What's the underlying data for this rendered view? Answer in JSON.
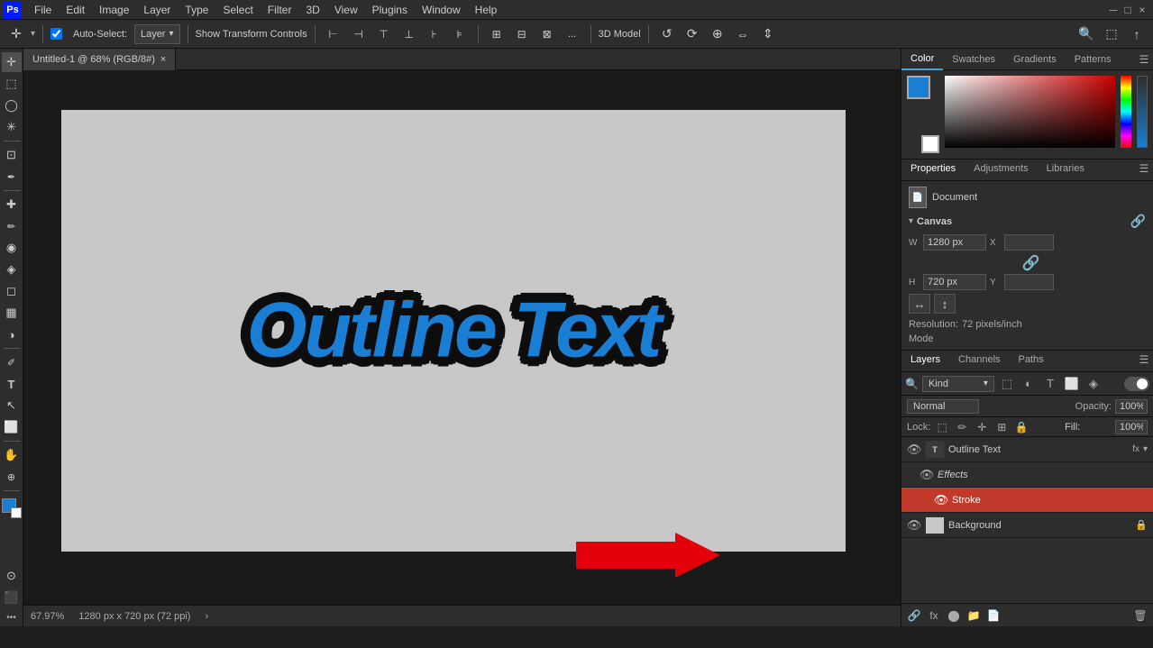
{
  "app": {
    "title": "Adobe Photoshop",
    "menu_items": [
      "Ps",
      "File",
      "Edit",
      "Image",
      "Layer",
      "Type",
      "Select",
      "Filter",
      "3D",
      "View",
      "Plugins",
      "Window",
      "Help"
    ]
  },
  "toolbar": {
    "auto_select_label": "Auto-Select:",
    "auto_select_type": "Layer",
    "show_transform_label": "Show Transform Controls",
    "mode_label": "3D Model",
    "extra_btn": "..."
  },
  "tab": {
    "title": "Untitled-1 @ 68% (RGB/8#)",
    "close": "×"
  },
  "color_panel": {
    "tabs": [
      "Color",
      "Swatches",
      "Gradients",
      "Patterns"
    ],
    "active_tab": "Color"
  },
  "swatches_panel": {
    "label": "Swatches"
  },
  "properties_panel": {
    "tabs": [
      "Properties",
      "Adjustments",
      "Libraries"
    ],
    "active_tab": "Properties",
    "doc_label": "Document",
    "canvas_label": "Canvas",
    "width_label": "W",
    "height_label": "H",
    "x_label": "X",
    "y_label": "Y",
    "width_val": "1280 px",
    "height_val": "720 px",
    "x_val": "",
    "y_val": "",
    "resolution_label": "Resolution:",
    "resolution_val": "72 pixels/inch",
    "mode_label": "Mode"
  },
  "layers_panel": {
    "tabs": [
      "Layers",
      "Channels",
      "Paths"
    ],
    "active_tab": "Layers",
    "filter_label": "Kind",
    "blend_mode": "Normal",
    "opacity_label": "Opacity:",
    "opacity_val": "100%",
    "lock_label": "Lock:",
    "fill_label": "Fill:",
    "fill_val": "100%",
    "layers": [
      {
        "name": "Outline Text",
        "type": "text",
        "visible": true,
        "selected": false,
        "fx": "fx",
        "has_effects": true,
        "indent": 0
      },
      {
        "name": "Effects",
        "type": "effects",
        "visible": true,
        "selected": false,
        "indent": 1
      },
      {
        "name": "Stroke",
        "type": "stroke",
        "visible": true,
        "selected": true,
        "indent": 2
      },
      {
        "name": "Background",
        "type": "background",
        "visible": true,
        "selected": false,
        "indent": 0,
        "locked": true
      }
    ]
  },
  "canvas_text": "Outline Text",
  "status_bar": {
    "zoom": "67.97%",
    "dimensions": "1280 px x 720 px (72 ppi)",
    "expand_icon": "›"
  },
  "icons": {
    "move": "✛",
    "marquee": "⬚",
    "lasso": "⌀",
    "magic_wand": "✳",
    "crop": "⊡",
    "eyedropper": "✒",
    "heal": "✚",
    "brush": "✏",
    "clone": "◉",
    "history": "◈",
    "eraser": "◻",
    "gradient": "▦",
    "dodge": "◑",
    "pen": "✐",
    "text": "T",
    "path_select": "↖",
    "shape": "⬜",
    "hand": "✋",
    "zoom": "🔍",
    "collapse": "«",
    "expand": "»",
    "settings": "☰",
    "link": "🔗",
    "lock": "🔒",
    "eye": "👁",
    "visibility": "●"
  }
}
